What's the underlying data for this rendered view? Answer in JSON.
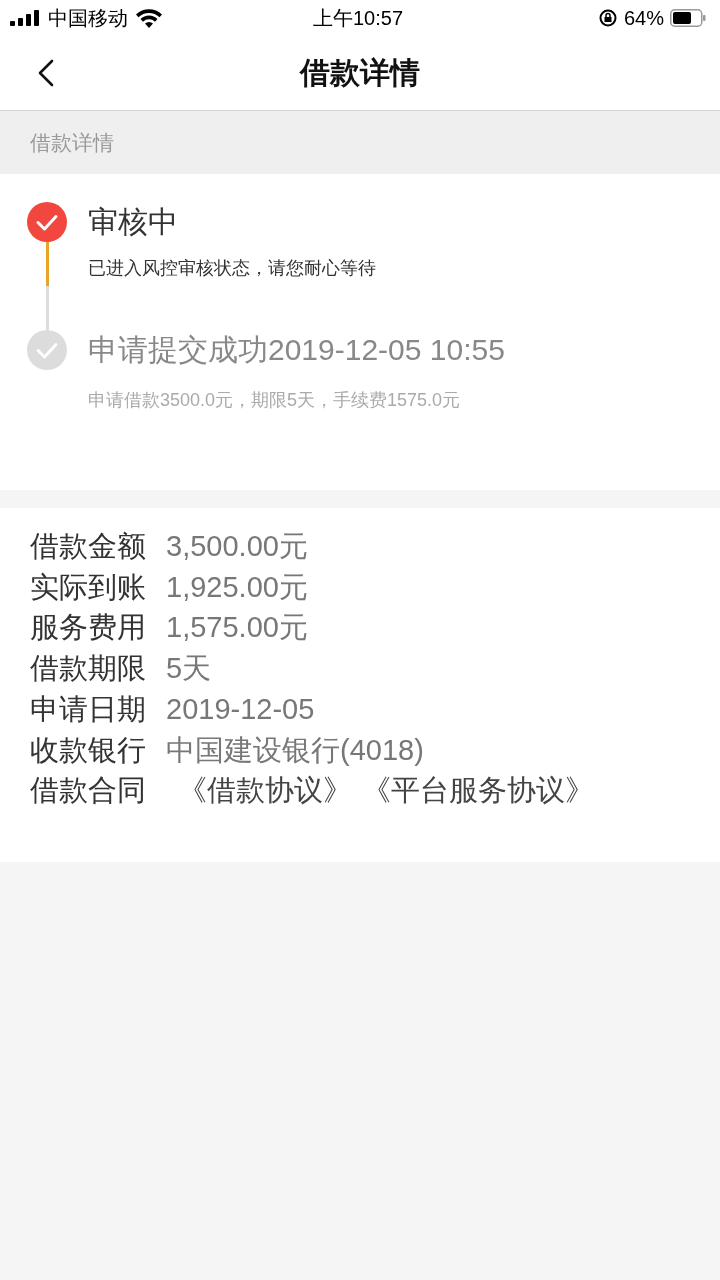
{
  "status_bar": {
    "carrier": "中国移动",
    "time": "上午10:57",
    "battery": "64%"
  },
  "nav": {
    "title": "借款详情"
  },
  "section_header": "借款详情",
  "timeline": [
    {
      "title": "审核中",
      "description": "已进入风控审核状态，请您耐心等待",
      "selected": true
    },
    {
      "title": "申请提交成功2019-12-05 10:55",
      "description": "申请借款3500.0元，期限5天，手续费1575.0元",
      "selected": false
    }
  ],
  "details": [
    {
      "kind": "text",
      "label": "借款金额",
      "value": "3,500.00元"
    },
    {
      "kind": "text",
      "label": "实际到账",
      "value": "1,925.00元"
    },
    {
      "kind": "text",
      "label": "服务费用",
      "value": "1,575.00元"
    },
    {
      "kind": "text",
      "label": "借款期限",
      "value": "5天"
    },
    {
      "kind": "text",
      "label": "申请日期",
      "value": "2019-12-05"
    },
    {
      "kind": "text",
      "label": "收款银行",
      "value": "中国建设银行(4018)"
    },
    {
      "kind": "links",
      "label": "借款合同",
      "links": [
        "《借款协议》",
        "《平台服务协议》"
      ]
    }
  ]
}
